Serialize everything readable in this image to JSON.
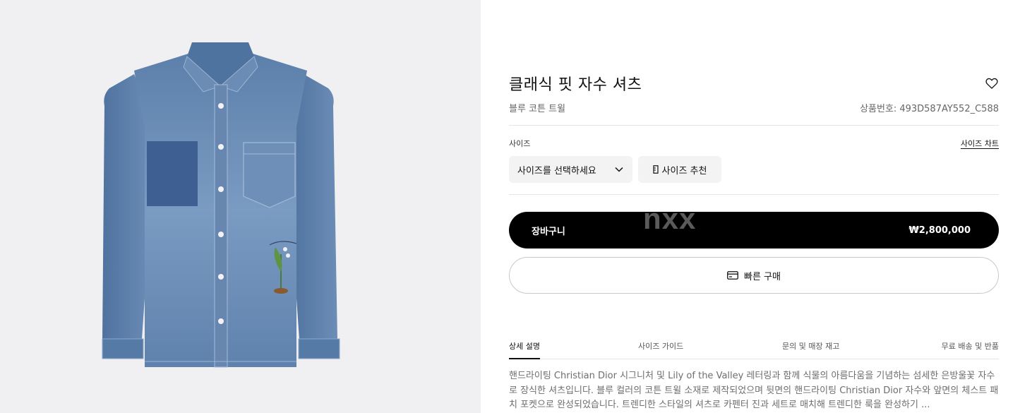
{
  "product": {
    "title": "클래식 핏 자수 셔츠",
    "subtitle": "블루 코튼 트윌",
    "reference_label": "상품번호:",
    "reference_value": "493D587AY552_C588",
    "image_alt": "denim shirt"
  },
  "size": {
    "label": "사이즈",
    "chart_link": "사이즈 차트",
    "select_placeholder": "사이즈를 선택하세요",
    "recommend_label": "사이즈 추천"
  },
  "cart": {
    "label": "장바구니",
    "price": "₩2,800,000"
  },
  "quick_buy": {
    "label": "빠른 구매"
  },
  "watermark": "nxx",
  "tabs": [
    {
      "label": "상세 설명",
      "active": true
    },
    {
      "label": "사이즈 가이드",
      "active": false
    },
    {
      "label": "문의 및 매장 재고",
      "active": false
    },
    {
      "label": "무료 배송 및 반품",
      "active": false
    }
  ],
  "description": "핸드라이팅 Christian Dior 시그니처 및 Lily of the Valley 레터링과 함께 식물의 아름다움을 기념하는 섬세한 은방울꽃 자수로 장식한 셔츠입니다. 블루 컬러의 코튼 트윌 소재로 제작되었으며 뒷면의 핸드라이팅 Christian Dior 자수와 앞면의 체스트 패치 포켓으로 완성되었습니다. 트렌디한 스타일의 셔츠로 카펜터 진과 세트로 매치해 트렌디한 룩을 완성하기 ...",
  "colors": {
    "left_background": "#f0f0f2",
    "denim_main": "#5d80ab",
    "denim_dark": "#3e5f91",
    "button_black": "#000000"
  },
  "icons": [
    "heart-icon",
    "chevron-down-icon",
    "ruler-icon",
    "card-icon"
  ]
}
